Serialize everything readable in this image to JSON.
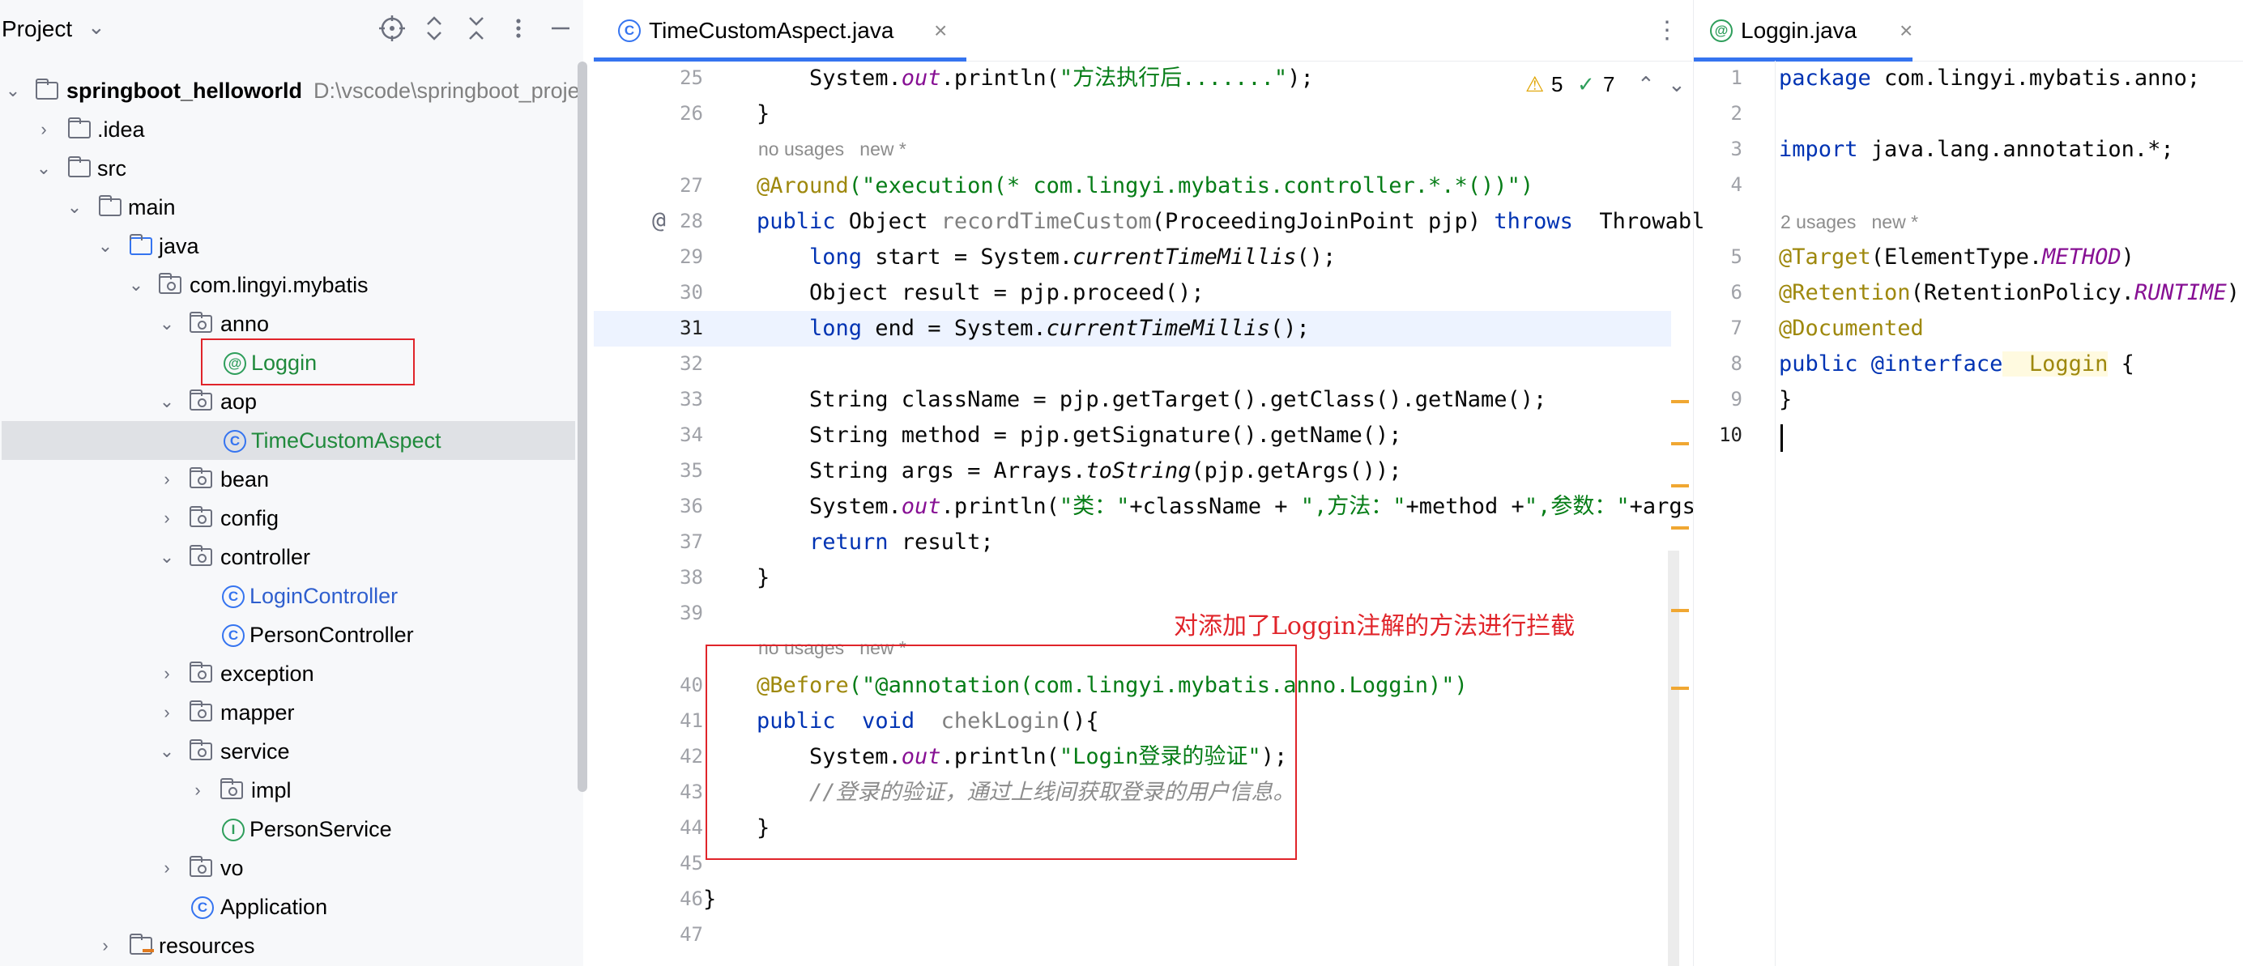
{
  "project_panel": {
    "title": "Project",
    "title_chevron": "⌄",
    "header_icons": [
      "target-icon",
      "expand-icon",
      "collapse-icon",
      "more-icon",
      "minimize-icon"
    ],
    "tree": [
      {
        "label": "springboot_helloworld",
        "suffix": "D:\\vscode\\springboot_proje",
        "icon": "module-folder",
        "expanded": true
      },
      {
        "label": ".idea",
        "icon": "folder",
        "expanded": false
      },
      {
        "label": "src",
        "icon": "folder",
        "expanded": true
      },
      {
        "label": "main",
        "icon": "folder",
        "expanded": true
      },
      {
        "label": "java",
        "icon": "folder",
        "expanded": true
      },
      {
        "label": "com.lingyi.mybatis",
        "icon": "package",
        "expanded": true
      },
      {
        "label": "anno",
        "icon": "package",
        "expanded": true
      },
      {
        "label": "Loggin",
        "icon": "annotation"
      },
      {
        "label": "aop",
        "icon": "package",
        "expanded": true
      },
      {
        "label": "TimeCustomAspect",
        "icon": "class"
      },
      {
        "label": "bean",
        "icon": "package",
        "expanded": false
      },
      {
        "label": "config",
        "icon": "package",
        "expanded": false
      },
      {
        "label": "controller",
        "icon": "package",
        "expanded": true
      },
      {
        "label": "LoginController",
        "icon": "class"
      },
      {
        "label": "PersonController",
        "icon": "class"
      },
      {
        "label": "exception",
        "icon": "package",
        "expanded": false
      },
      {
        "label": "mapper",
        "icon": "package",
        "expanded": false
      },
      {
        "label": "service",
        "icon": "package",
        "expanded": true
      },
      {
        "label": "impl",
        "icon": "package",
        "expanded": false
      },
      {
        "label": "PersonService",
        "icon": "interface"
      },
      {
        "label": "vo",
        "icon": "package",
        "expanded": false
      },
      {
        "label": "Application",
        "icon": "class"
      },
      {
        "label": "resources",
        "icon": "resources-folder",
        "expanded": false
      }
    ]
  },
  "editor1": {
    "tab_label": "TimeCustomAspect.java",
    "tab_close": "×",
    "more": "⋮",
    "inspections": {
      "warnings": "5",
      "checks": "7"
    },
    "hints": {
      "no_usages_1": "no usages   new *",
      "no_usages_2": "no usages   new *"
    },
    "line_numbers": [
      "25",
      "26",
      "27",
      "28",
      "29",
      "30",
      "31",
      "32",
      "33",
      "34",
      "35",
      "36",
      "37",
      "38",
      "39",
      "40",
      "41",
      "42",
      "43",
      "44",
      "45",
      "46",
      "47"
    ],
    "gutter_at": "@",
    "lines": {
      "l25": "System.out.println(\"方法执行后.......\");",
      "l26": "}",
      "l27_ann": "@Around",
      "l27_str": "(\"execution(* com.lingyi.mybatis.controller.*.*())\")",
      "l28_a": "public",
      "l28_b": " Object ",
      "l28_c": "recordTimeCustom",
      "l28_d": "(ProceedingJoinPoint pjp) ",
      "l28_e": "throws",
      "l28_f": "  Throwabl",
      "l29_a": "long",
      "l29_b": " start = System.",
      "l29_c": "currentTimeMillis",
      "l29_d": "();",
      "l30": "Object result = pjp.proceed();",
      "l31_a": "long",
      "l31_b": " end = System.",
      "l31_c": "currentTimeMillis",
      "l31_d": "();",
      "l33": "String className = pjp.getTarget().getClass().getName();",
      "l34": "String method = pjp.getSignature().getName();",
      "l35_a": "String args = Arrays.",
      "l35_b": "toString",
      "l35_c": "(pjp.getArgs());",
      "l36_a": "System.",
      "l36_b": "out",
      "l36_c": ".println(",
      "l36_d": "\"类：\"",
      "l36_e": "+className + ",
      "l36_f": "\",方法：\"",
      "l36_g": "+method +",
      "l36_h": "\",参数：\"",
      "l36_i": "+args",
      "l37_a": "return",
      "l37_b": " result;",
      "l38": "}",
      "l40_ann": "@Before",
      "l40_str": "(\"@annotation(com.lingyi.mybatis.anno.Loggin)\")",
      "l41_a": "public",
      "l41_b": "  void",
      "l41_c": "  chekLogin",
      "l41_d": "(){",
      "l42_a": "System.",
      "l42_b": "out",
      "l42_c": ".println(",
      "l42_d": "\"Login登录的验证\"",
      "l42_e": ");",
      "l43": "//登录的验证，通过上线间获取登录的用户信息。",
      "l44": "}",
      "l46": "}"
    },
    "red_note": "对添加了Loggin注解的方法进行拦截"
  },
  "editor2": {
    "tab_label": "Loggin.java",
    "tab_close": "×",
    "line_numbers": [
      "1",
      "2",
      "3",
      "4",
      "5",
      "6",
      "7",
      "8",
      "9",
      "10"
    ],
    "hint": "2 usages   new *",
    "lines": {
      "l1_a": "package",
      "l1_b": " com.lingyi.mybatis.anno;",
      "l3_a": "import",
      "l3_b": " java.lang.annotation.*;",
      "l5_a": "@Target",
      "l5_b": "(ElementType.",
      "l5_c": "METHOD",
      "l5_d": ")",
      "l6_a": "@Retention",
      "l6_b": "(RetentionPolicy.",
      "l6_c": "RUNTIME",
      "l6_d": ")",
      "l7": "@Documented",
      "l8_a": "public",
      "l8_b": " @interface",
      "l8_c": "  Loggin",
      "l8_d": " {",
      "l9": "}"
    }
  }
}
